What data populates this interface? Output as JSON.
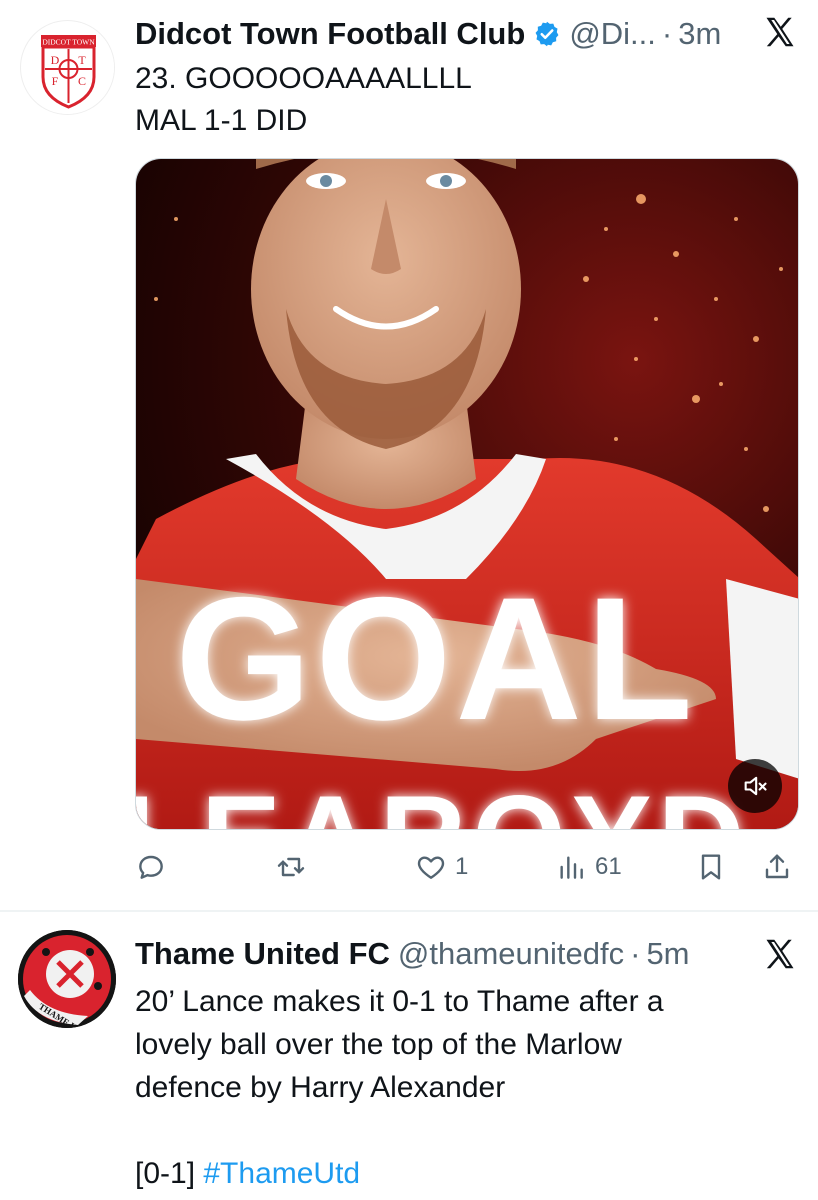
{
  "tweets": [
    {
      "name": "Didcot Town Football Club",
      "handle": "@Di...",
      "separator": "·",
      "time": "3m",
      "verified": true,
      "text_lines": [
        "23. GOOOOOAAAALLLL",
        "MAL 1-1 DID"
      ],
      "media": {
        "type": "video",
        "overlay_text": "GOAL",
        "bottom_text": "LEAROYD",
        "muted": true
      },
      "avatar_logo_text": [
        "DIDCOT TOWN",
        "D",
        "T",
        "F",
        "C"
      ],
      "actions": {
        "reply_icon": "reply-icon",
        "retweet_icon": "retweet-icon",
        "like_icon": "heart-icon",
        "like_count": "1",
        "views_icon": "views-icon",
        "views_count": "61",
        "bookmark_icon": "bookmark-icon",
        "share_icon": "share-icon"
      }
    },
    {
      "name": "Thame United FC",
      "handle": "@thameunitedfc",
      "separator": "·",
      "time": "5m",
      "text_lines": [
        "20’ Lance makes it 0-1 to Thame after a",
        "lovely ball over the top of the Marlow",
        "defence by Harry Alexander",
        "",
        "[0-1] "
      ],
      "hashtag": "#ThameUtd",
      "avatar_logo_text": "THAME UNITED FC"
    }
  ],
  "colors": {
    "text": "#0f1419",
    "secondary": "#536471",
    "link": "#1d9bf0",
    "verified": "#1d9bf0",
    "club_red": "#d9232e"
  }
}
